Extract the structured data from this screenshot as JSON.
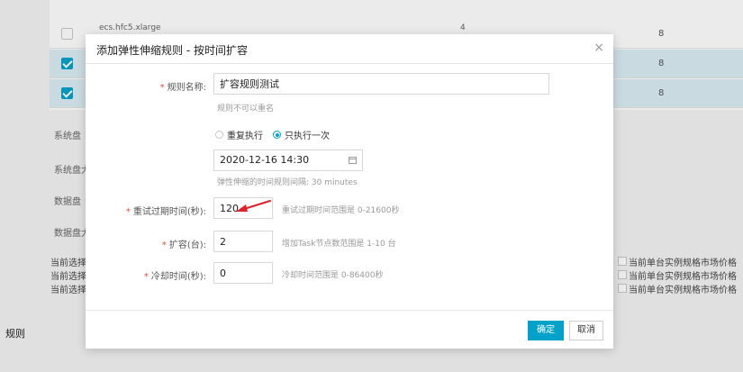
{
  "background": {
    "table": {
      "rows": [
        {
          "checked": false,
          "name": "ecs.hfc5.xlarge",
          "cores": "4",
          "memory": "8"
        },
        {
          "checked": true,
          "name": "",
          "cores": "",
          "memory": "8"
        },
        {
          "checked": true,
          "name": "",
          "cores": "",
          "memory": "8"
        }
      ]
    },
    "left_labels": [
      "系统盘",
      "系统盘大",
      "数据盘",
      "数据盘大"
    ],
    "price_left_labels": [
      "当前选择",
      "当前选择",
      "当前选择"
    ],
    "price_right_labels": [
      "当前单台实例规格市场价格",
      "当前单台实例规格市场价格",
      "当前单台实例规格市场价格"
    ],
    "bottom_label": "规则"
  },
  "dialog": {
    "title": "添加弹性伸缩规则 - 按时间扩容",
    "close_glyph": "×",
    "rule_name": {
      "label": "规则名称:",
      "value": "扩容规则测试",
      "hint": "规则不可以重名"
    },
    "schedule": {
      "option_repeat": "重复执行",
      "option_once": "只执行一次",
      "selected": "once",
      "datetime": "2020-12-16 14:30",
      "hint": "弹性伸缩的时间规则间隔: 30 minutes"
    },
    "retry_timeout": {
      "label": "重试过期时间(秒):",
      "value": "120",
      "hint": "重试过期时间范围是 0-21600秒"
    },
    "scale_out": {
      "label": "扩容(台):",
      "value": "2",
      "hint": "增加Task节点数范围是 1-10 台"
    },
    "cooldown": {
      "label": "冷却时间(秒):",
      "value": "0",
      "hint": "冷却时间范围是 0-86400秒"
    },
    "required_mark": "*",
    "ok_label": "确定",
    "cancel_label": "取消"
  },
  "colors": {
    "accent": "#00a2ca",
    "annotation_arrow": "#e0202a",
    "required": "#e64a3c"
  },
  "icons": {
    "close": "close-icon",
    "calendar": "calendar-icon",
    "annotation": "red-arrow-annotation"
  }
}
